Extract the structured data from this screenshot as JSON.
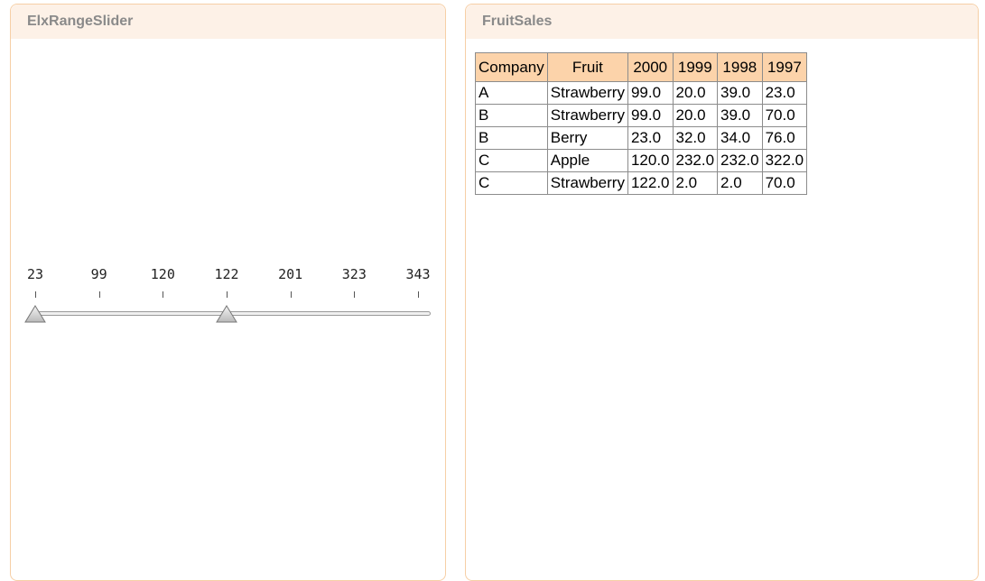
{
  "slider_panel": {
    "title": "ElxRangeSlider",
    "ticks": [
      "23",
      "99",
      "120",
      "122",
      "201",
      "323",
      "343"
    ],
    "low_index": 0,
    "high_index": 3
  },
  "sales_panel": {
    "title": "FruitSales",
    "columns": [
      "Company",
      "Fruit",
      "2000",
      "1999",
      "1998",
      "1997"
    ],
    "rows": [
      [
        "A",
        "Strawberry",
        "99.0",
        "20.0",
        "39.0",
        "23.0"
      ],
      [
        "B",
        "Strawberry",
        "99.0",
        "20.0",
        "39.0",
        "70.0"
      ],
      [
        "B",
        "Berry",
        "23.0",
        "32.0",
        "34.0",
        "76.0"
      ],
      [
        "C",
        "Apple",
        "120.0",
        "232.0",
        "232.0",
        "322.0"
      ],
      [
        "C",
        "Strawberry",
        "122.0",
        "2.0",
        "2.0",
        "70.0"
      ]
    ]
  },
  "colors": {
    "border": "#f6cfa6",
    "header_bg": "#fdf1e7",
    "table_header_bg": "#fcd3aa"
  }
}
